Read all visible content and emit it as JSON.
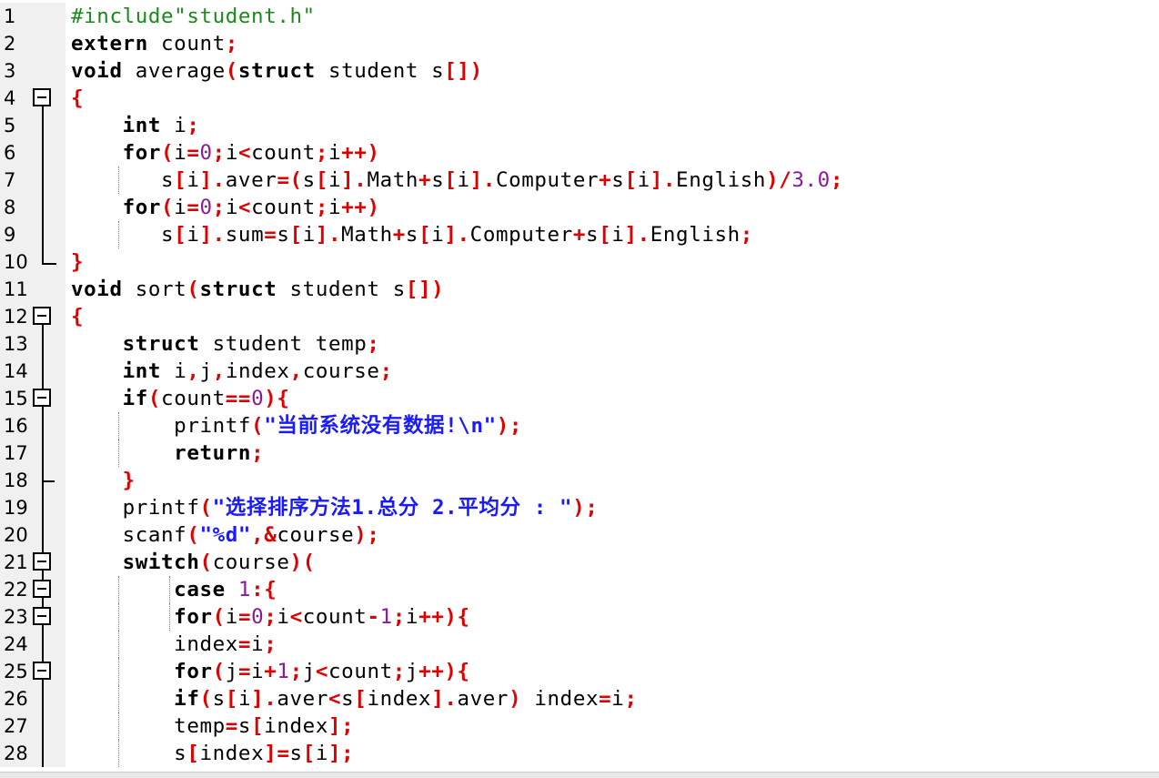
{
  "editor": {
    "lines": [
      {
        "n": "1",
        "fold": "",
        "guides": [],
        "tokens": [
          [
            "p",
            "#include\"student.h\""
          ]
        ]
      },
      {
        "n": "2",
        "fold": "",
        "guides": [],
        "tokens": [
          [
            "k",
            "extern"
          ],
          [
            "t",
            " count"
          ],
          [
            "o",
            ";"
          ]
        ]
      },
      {
        "n": "3",
        "fold": "",
        "guides": [],
        "tokens": [
          [
            "k",
            "void"
          ],
          [
            "t",
            " average"
          ],
          [
            "o",
            "("
          ],
          [
            "k",
            "struct"
          ],
          [
            "t",
            " student s"
          ],
          [
            "o",
            "[])"
          ]
        ]
      },
      {
        "n": "4",
        "fold": "box",
        "guides": [],
        "tokens": [
          [
            "o",
            "{"
          ]
        ]
      },
      {
        "n": "5",
        "fold": "line",
        "guides": [],
        "tokens": [
          [
            "t",
            "    "
          ],
          [
            "k",
            "int"
          ],
          [
            "t",
            " i"
          ],
          [
            "o",
            ";"
          ]
        ]
      },
      {
        "n": "6",
        "fold": "line",
        "guides": [],
        "tokens": [
          [
            "t",
            "    "
          ],
          [
            "k",
            "for"
          ],
          [
            "o",
            "("
          ],
          [
            "t",
            "i"
          ],
          [
            "o",
            "="
          ],
          [
            "n",
            "0"
          ],
          [
            "o",
            ";"
          ],
          [
            "t",
            "i"
          ],
          [
            "o",
            "<"
          ],
          [
            "t",
            "count"
          ],
          [
            "o",
            ";"
          ],
          [
            "t",
            "i"
          ],
          [
            "o",
            "++)"
          ]
        ]
      },
      {
        "n": "7",
        "fold": "line",
        "guides": [
          130
        ],
        "tokens": [
          [
            "t",
            "       s"
          ],
          [
            "o",
            "["
          ],
          [
            "t",
            "i"
          ],
          [
            "o",
            "]."
          ],
          [
            "t",
            "aver"
          ],
          [
            "o",
            "=("
          ],
          [
            "t",
            "s"
          ],
          [
            "o",
            "["
          ],
          [
            "t",
            "i"
          ],
          [
            "o",
            "]."
          ],
          [
            "t",
            "Math"
          ],
          [
            "o",
            "+"
          ],
          [
            "t",
            "s"
          ],
          [
            "o",
            "["
          ],
          [
            "t",
            "i"
          ],
          [
            "o",
            "]."
          ],
          [
            "t",
            "Computer"
          ],
          [
            "o",
            "+"
          ],
          [
            "t",
            "s"
          ],
          [
            "o",
            "["
          ],
          [
            "t",
            "i"
          ],
          [
            "o",
            "]."
          ],
          [
            "t",
            "English"
          ],
          [
            "o",
            ")/"
          ],
          [
            "n",
            "3.0"
          ],
          [
            "o",
            ";"
          ]
        ]
      },
      {
        "n": "8",
        "fold": "line",
        "guides": [],
        "tokens": [
          [
            "t",
            "    "
          ],
          [
            "k",
            "for"
          ],
          [
            "o",
            "("
          ],
          [
            "t",
            "i"
          ],
          [
            "o",
            "="
          ],
          [
            "n",
            "0"
          ],
          [
            "o",
            ";"
          ],
          [
            "t",
            "i"
          ],
          [
            "o",
            "<"
          ],
          [
            "t",
            "count"
          ],
          [
            "o",
            ";"
          ],
          [
            "t",
            "i"
          ],
          [
            "o",
            "++)"
          ]
        ]
      },
      {
        "n": "9",
        "fold": "line",
        "guides": [
          130
        ],
        "tokens": [
          [
            "t",
            "       s"
          ],
          [
            "o",
            "["
          ],
          [
            "t",
            "i"
          ],
          [
            "o",
            "]."
          ],
          [
            "t",
            "sum"
          ],
          [
            "o",
            "="
          ],
          [
            "t",
            "s"
          ],
          [
            "o",
            "["
          ],
          [
            "t",
            "i"
          ],
          [
            "o",
            "]."
          ],
          [
            "t",
            "Math"
          ],
          [
            "o",
            "+"
          ],
          [
            "t",
            "s"
          ],
          [
            "o",
            "["
          ],
          [
            "t",
            "i"
          ],
          [
            "o",
            "]."
          ],
          [
            "t",
            "Computer"
          ],
          [
            "o",
            "+"
          ],
          [
            "t",
            "s"
          ],
          [
            "o",
            "["
          ],
          [
            "t",
            "i"
          ],
          [
            "o",
            "]."
          ],
          [
            "t",
            "English"
          ],
          [
            "o",
            ";"
          ]
        ]
      },
      {
        "n": "10",
        "fold": "end",
        "guides": [],
        "tokens": [
          [
            "o",
            "}"
          ]
        ]
      },
      {
        "n": "11",
        "fold": "",
        "guides": [],
        "tokens": [
          [
            "k",
            "void"
          ],
          [
            "t",
            " sort"
          ],
          [
            "o",
            "("
          ],
          [
            "k",
            "struct"
          ],
          [
            "t",
            " student s"
          ],
          [
            "o",
            "[])"
          ]
        ]
      },
      {
        "n": "12",
        "fold": "box",
        "guides": [],
        "tokens": [
          [
            "o",
            "{"
          ]
        ]
      },
      {
        "n": "13",
        "fold": "line",
        "guides": [],
        "tokens": [
          [
            "t",
            "    "
          ],
          [
            "k",
            "struct"
          ],
          [
            "t",
            " student temp"
          ],
          [
            "o",
            ";"
          ]
        ]
      },
      {
        "n": "14",
        "fold": "line",
        "guides": [],
        "tokens": [
          [
            "t",
            "    "
          ],
          [
            "k",
            "int"
          ],
          [
            "t",
            " i"
          ],
          [
            "o",
            ","
          ],
          [
            "t",
            "j"
          ],
          [
            "o",
            ","
          ],
          [
            "t",
            "index"
          ],
          [
            "o",
            ","
          ],
          [
            "t",
            "course"
          ],
          [
            "o",
            ";"
          ]
        ]
      },
      {
        "n": "15",
        "fold": "box",
        "guides": [],
        "tokens": [
          [
            "t",
            "    "
          ],
          [
            "k",
            "if"
          ],
          [
            "o",
            "("
          ],
          [
            "t",
            "count"
          ],
          [
            "o",
            "=="
          ],
          [
            "n",
            "0"
          ],
          [
            "o",
            "){"
          ]
        ]
      },
      {
        "n": "16",
        "fold": "line",
        "guides": [
          130
        ],
        "tokens": [
          [
            "t",
            "        printf"
          ],
          [
            "o",
            "("
          ],
          [
            "s",
            "\"当前系统没有数据!\\n\""
          ],
          [
            "o",
            ");"
          ]
        ]
      },
      {
        "n": "17",
        "fold": "line",
        "guides": [
          130
        ],
        "tokens": [
          [
            "t",
            "        "
          ],
          [
            "k",
            "return"
          ],
          [
            "o",
            ";"
          ]
        ]
      },
      {
        "n": "18",
        "fold": "tick",
        "guides": [],
        "tokens": [
          [
            "t",
            "    "
          ],
          [
            "o",
            "}"
          ]
        ]
      },
      {
        "n": "19",
        "fold": "line",
        "guides": [],
        "tokens": [
          [
            "t",
            "    printf"
          ],
          [
            "o",
            "("
          ],
          [
            "s",
            "\"选择排序方法1.总分 2.平均分 : \""
          ],
          [
            "o",
            ");"
          ]
        ]
      },
      {
        "n": "20",
        "fold": "line",
        "guides": [],
        "tokens": [
          [
            "t",
            "    scanf"
          ],
          [
            "o",
            "("
          ],
          [
            "s",
            "\"%d\""
          ],
          [
            "o",
            ",&"
          ],
          [
            "t",
            "course"
          ],
          [
            "o",
            ");"
          ]
        ]
      },
      {
        "n": "21",
        "fold": "box",
        "guides": [],
        "tokens": [
          [
            "t",
            "    "
          ],
          [
            "k",
            "switch"
          ],
          [
            "o",
            "("
          ],
          [
            "t",
            "course"
          ],
          [
            "o",
            ")("
          ]
        ]
      },
      {
        "n": "22",
        "fold": "box",
        "guides": [
          130,
          186
        ],
        "tokens": [
          [
            "t",
            "        "
          ],
          [
            "k",
            "case"
          ],
          [
            "t",
            " "
          ],
          [
            "n",
            "1"
          ],
          [
            "o",
            ":{"
          ]
        ]
      },
      {
        "n": "23",
        "fold": "box",
        "guides": [
          130,
          186
        ],
        "tokens": [
          [
            "t",
            "        "
          ],
          [
            "k",
            "for"
          ],
          [
            "o",
            "("
          ],
          [
            "t",
            "i"
          ],
          [
            "o",
            "="
          ],
          [
            "n",
            "0"
          ],
          [
            "o",
            ";"
          ],
          [
            "t",
            "i"
          ],
          [
            "o",
            "<"
          ],
          [
            "t",
            "count"
          ],
          [
            "o",
            "-"
          ],
          [
            "n",
            "1"
          ],
          [
            "o",
            ";"
          ],
          [
            "t",
            "i"
          ],
          [
            "o",
            "++){"
          ]
        ]
      },
      {
        "n": "24",
        "fold": "line",
        "guides": [
          130
        ],
        "tokens": [
          [
            "t",
            "        index"
          ],
          [
            "o",
            "="
          ],
          [
            "t",
            "i"
          ],
          [
            "o",
            ";"
          ]
        ]
      },
      {
        "n": "25",
        "fold": "box",
        "guides": [
          130
        ],
        "tokens": [
          [
            "t",
            "        "
          ],
          [
            "k",
            "for"
          ],
          [
            "o",
            "("
          ],
          [
            "t",
            "j"
          ],
          [
            "o",
            "="
          ],
          [
            "t",
            "i"
          ],
          [
            "o",
            "+"
          ],
          [
            "n",
            "1"
          ],
          [
            "o",
            ";"
          ],
          [
            "t",
            "j"
          ],
          [
            "o",
            "<"
          ],
          [
            "t",
            "count"
          ],
          [
            "o",
            ";"
          ],
          [
            "t",
            "j"
          ],
          [
            "o",
            "++){"
          ]
        ]
      },
      {
        "n": "26",
        "fold": "line",
        "guides": [
          130
        ],
        "tokens": [
          [
            "t",
            "        "
          ],
          [
            "k",
            "if"
          ],
          [
            "o",
            "("
          ],
          [
            "t",
            "s"
          ],
          [
            "o",
            "["
          ],
          [
            "t",
            "i"
          ],
          [
            "o",
            "]."
          ],
          [
            "t",
            "aver"
          ],
          [
            "o",
            "<"
          ],
          [
            "t",
            "s"
          ],
          [
            "o",
            "["
          ],
          [
            "t",
            "index"
          ],
          [
            "o",
            "]."
          ],
          [
            "t",
            "aver"
          ],
          [
            "o",
            ")"
          ],
          [
            "t",
            " index"
          ],
          [
            "o",
            "="
          ],
          [
            "t",
            "i"
          ],
          [
            "o",
            ";"
          ]
        ]
      },
      {
        "n": "27",
        "fold": "line",
        "guides": [
          130
        ],
        "tokens": [
          [
            "t",
            "        temp"
          ],
          [
            "o",
            "="
          ],
          [
            "t",
            "s"
          ],
          [
            "o",
            "["
          ],
          [
            "t",
            "index"
          ],
          [
            "o",
            "];"
          ]
        ]
      },
      {
        "n": "28",
        "fold": "line",
        "guides": [
          130
        ],
        "tokens": [
          [
            "t",
            "        s"
          ],
          [
            "o",
            "["
          ],
          [
            "t",
            "index"
          ],
          [
            "o",
            "]="
          ],
          [
            "t",
            "s"
          ],
          [
            "o",
            "["
          ],
          [
            "t",
            "i"
          ],
          [
            "o",
            "];"
          ]
        ]
      }
    ]
  }
}
